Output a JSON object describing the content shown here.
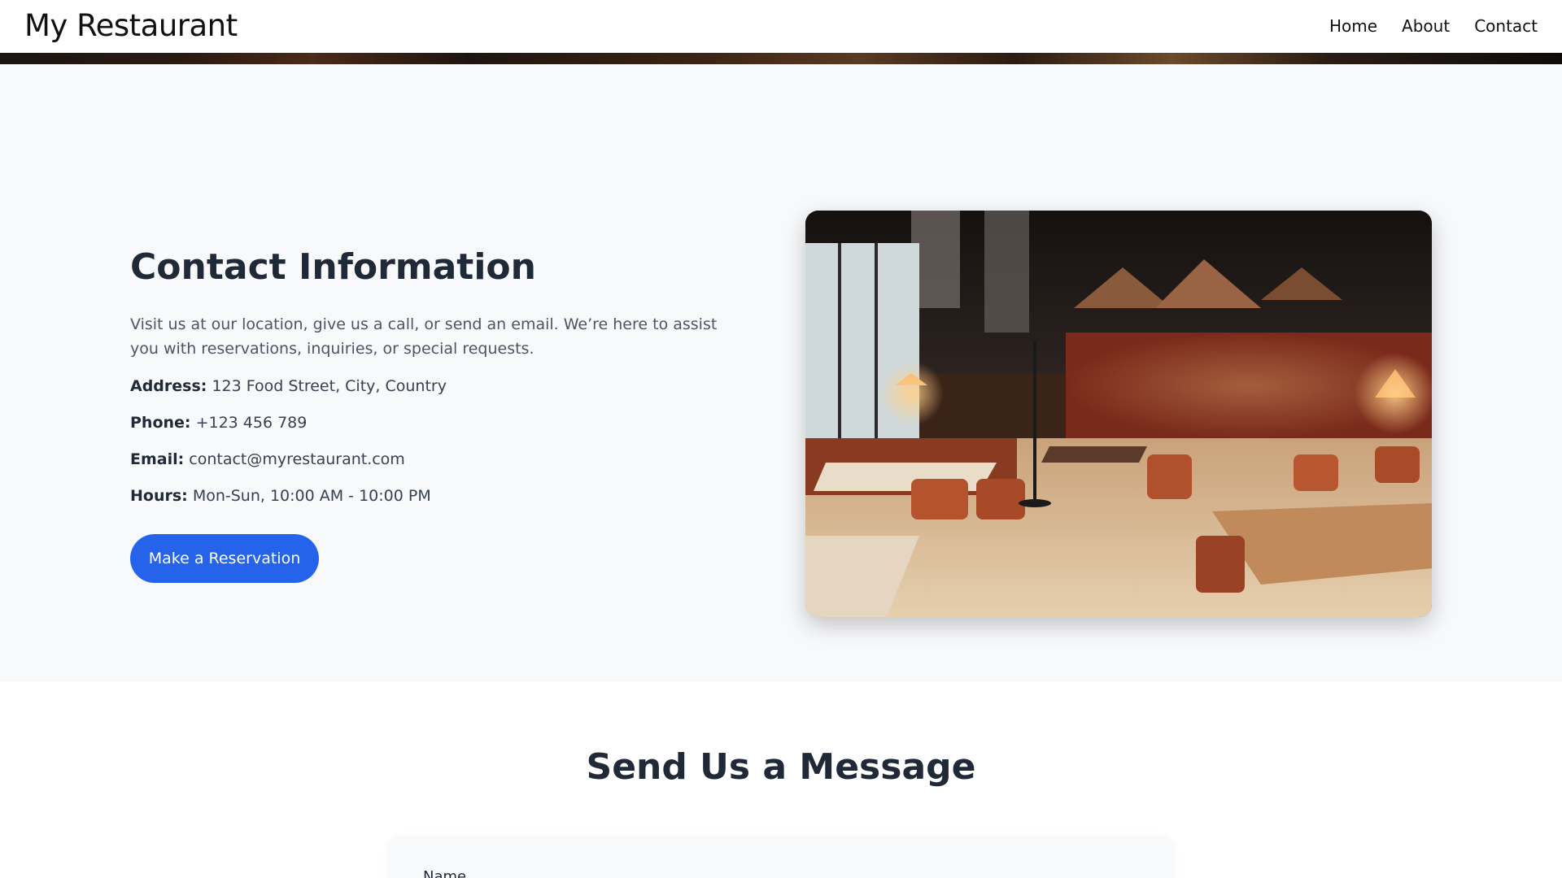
{
  "header": {
    "brand": "My Restaurant",
    "nav": [
      "Home",
      "About",
      "Contact"
    ]
  },
  "contact": {
    "title": "Contact Information",
    "description": "Visit us at our location, give us a call, or send an email. We’re here to assist you with reservations, inquiries, or special requests.",
    "address_label": "Address:",
    "address_value": "123 Food Street, City, Country",
    "phone_label": "Phone:",
    "phone_value": "+123 456 789",
    "email_label": "Email:",
    "email_value": "contact@myrestaurant.com",
    "hours_label": "Hours:",
    "hours_value": "Mon-Sun, 10:00 AM - 10:00 PM",
    "reserve_button": "Make a Reservation"
  },
  "message": {
    "title": "Send Us a Message",
    "name_label": "Name"
  },
  "colors": {
    "accent": "#2563eb",
    "section_bg": "#f8f9fb",
    "heading": "#1f2937"
  }
}
